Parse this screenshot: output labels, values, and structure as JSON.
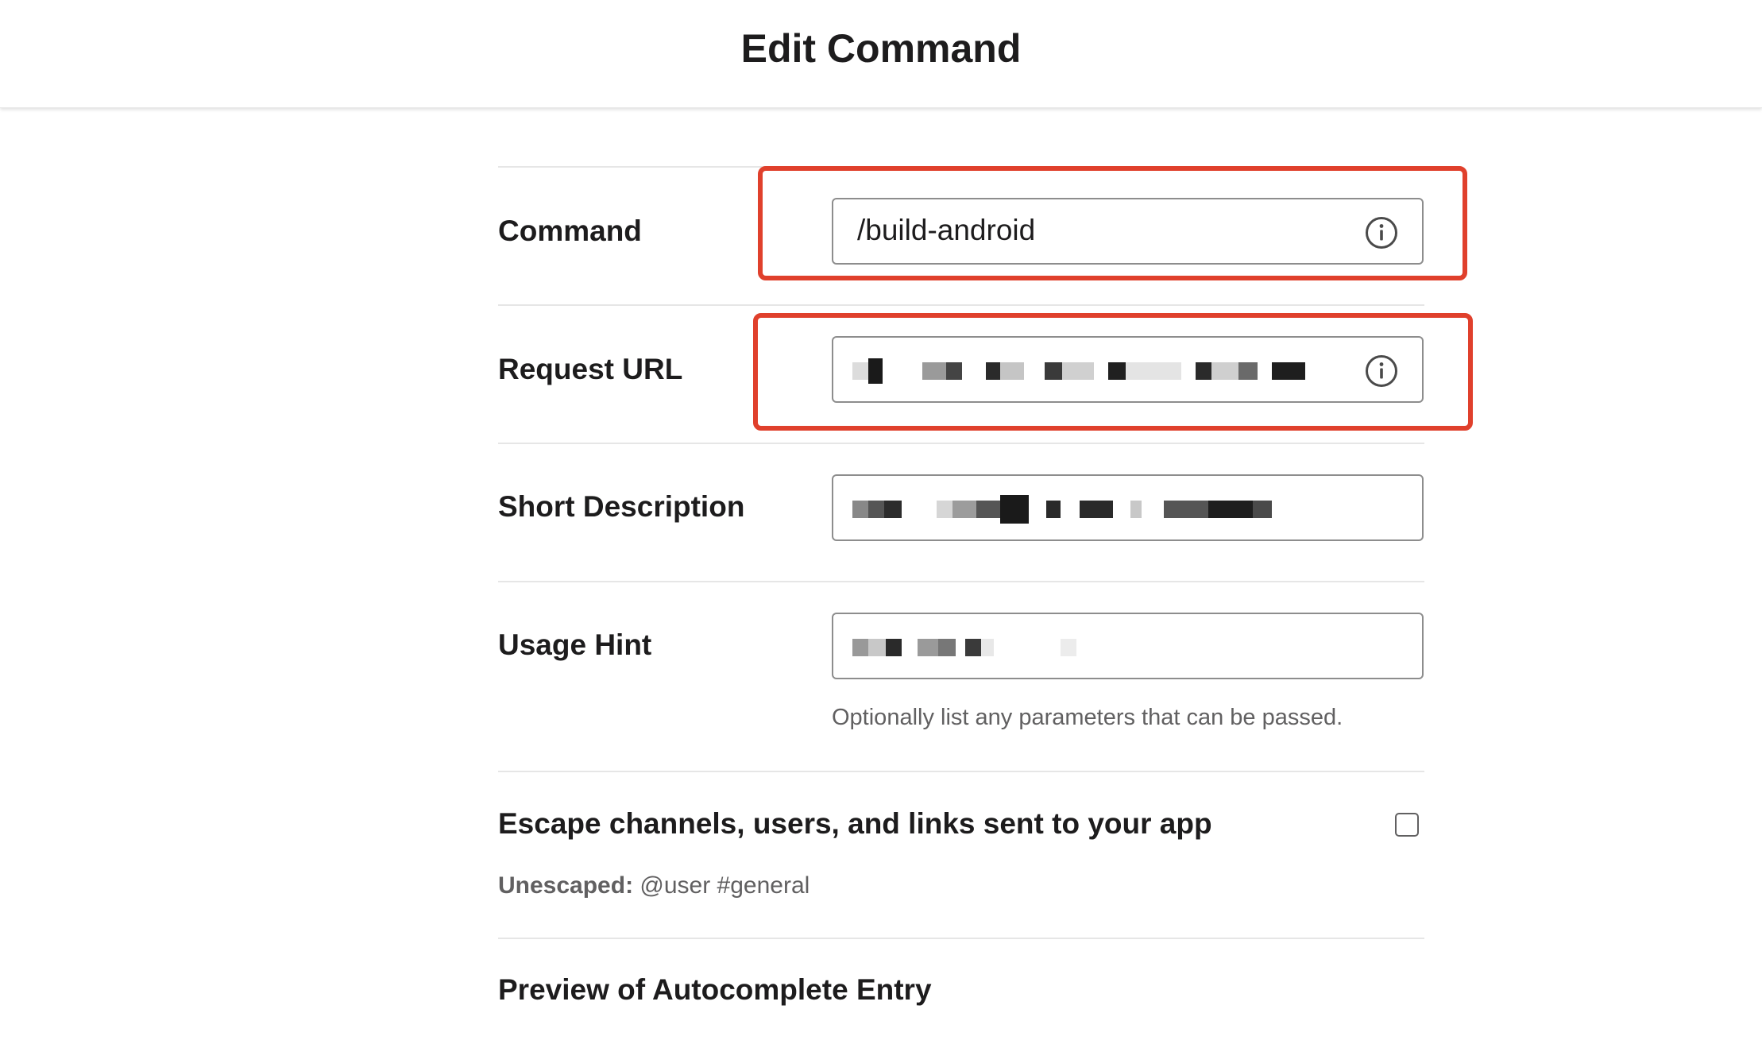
{
  "header": {
    "title": "Edit Command"
  },
  "form": {
    "command": {
      "label": "Command",
      "value": "/build-android"
    },
    "request_url": {
      "label": "Request URL",
      "value": ""
    },
    "short_description": {
      "label": "Short Description",
      "value": ""
    },
    "usage_hint": {
      "label": "Usage Hint",
      "value": "",
      "helper": "Optionally list any parameters that can be passed."
    },
    "escape": {
      "label": "Escape channels, users, and links sent to your app",
      "checked": false,
      "unescaped_label": "Unescaped:",
      "unescaped_example": "@user #general"
    },
    "preview": {
      "label": "Preview of Autocomplete Entry"
    }
  },
  "colors": {
    "highlight": "#e0402c",
    "border": "#8d8d8d",
    "muted_text": "#616061"
  },
  "icons": {
    "info": "info-icon",
    "checkbox": "checkbox-unchecked"
  }
}
